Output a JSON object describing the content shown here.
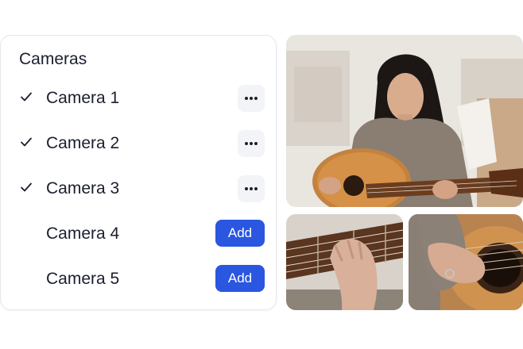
{
  "panel": {
    "title": "Cameras",
    "items": [
      {
        "label": "Camera 1",
        "selected": true,
        "action": "more"
      },
      {
        "label": "Camera 2",
        "selected": true,
        "action": "more"
      },
      {
        "label": "Camera 3",
        "selected": true,
        "action": "more"
      },
      {
        "label": "Camera 4",
        "selected": false,
        "action": "Add"
      },
      {
        "label": "Camera 5",
        "selected": false,
        "action": "Add"
      }
    ]
  },
  "icons": {
    "check": "check-icon",
    "more": "more-horizontal-icon"
  },
  "colors": {
    "accent": "#2a56e0",
    "text": "#1b1f2e",
    "more_bg": "#f3f4f7"
  },
  "media": {
    "feeds": [
      "camera-feed-1",
      "camera-feed-2",
      "camera-feed-3"
    ]
  }
}
